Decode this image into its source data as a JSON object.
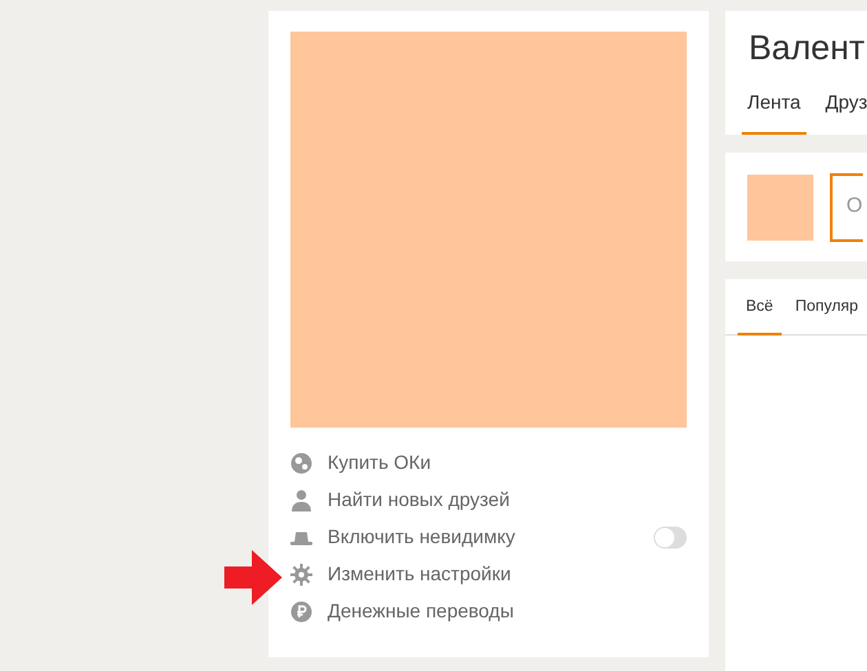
{
  "menu": [
    {
      "kind": "coins",
      "label": "Купить ОКи"
    },
    {
      "kind": "person",
      "label": "Найти новых друзей"
    },
    {
      "kind": "hat",
      "label": "Включить невидимку",
      "toggle": {
        "on": false
      }
    },
    {
      "kind": "gear",
      "label": "Изменить настройки"
    },
    {
      "kind": "ruble",
      "label": "Денежные переводы"
    }
  ],
  "profile": {
    "title": "Валент",
    "tabs": [
      {
        "label": "Лента",
        "selected": true
      },
      {
        "label": "Друз",
        "selected": false
      }
    ]
  },
  "post_box": {
    "placeholder": "О"
  },
  "feed_tabs": [
    {
      "label": "Всё",
      "selected": true
    },
    {
      "label": "Популяр",
      "selected": false
    }
  ]
}
